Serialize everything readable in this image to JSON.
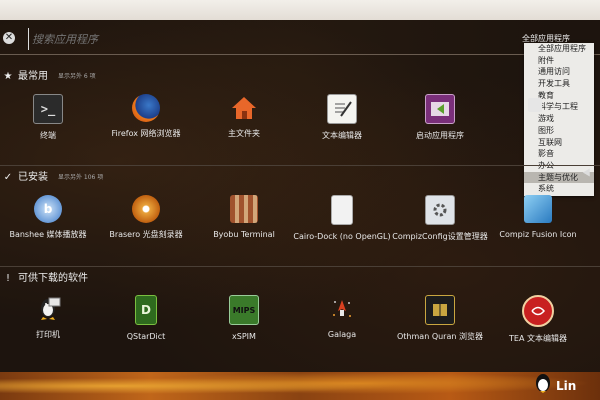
{
  "search": {
    "placeholder": "搜索应用程序"
  },
  "filter": {
    "label": "全部应用程序",
    "options": [
      "全部应用程序",
      "附件",
      "通用访问",
      "开发工具",
      "教育",
      "科学与工程",
      "游戏",
      "图形",
      "互联网",
      "影音",
      "办公",
      "主题与优化",
      "系统"
    ],
    "selected_index": 11
  },
  "sections": [
    {
      "title": "最常用",
      "more": "显示另外 6 项",
      "icon": "star-icon",
      "apps": [
        {
          "label": "终端",
          "icon": "terminal-icon"
        },
        {
          "label": "Firefox 网络浏览器",
          "icon": "firefox-icon"
        },
        {
          "label": "主文件夹",
          "icon": "home-folder-icon"
        },
        {
          "label": "文本编辑器",
          "icon": "text-editor-icon"
        },
        {
          "label": "启动应用程序",
          "icon": "startup-apps-icon"
        }
      ]
    },
    {
      "title": "已安装",
      "more": "显示另外 106 项",
      "icon": "check-circle-icon",
      "apps": [
        {
          "label": "Banshee 媒体播放器",
          "icon": "banshee-icon"
        },
        {
          "label": "Brasero 光盘刻录器",
          "icon": "brasero-icon"
        },
        {
          "label": "Byobu Terminal",
          "icon": "byobu-icon"
        },
        {
          "label": "Cairo-Dock (no OpenGL)",
          "icon": "cairo-dock-icon"
        },
        {
          "label": "CompizConfig设置管理器",
          "icon": "compizconfig-icon"
        },
        {
          "label": "Compiz Fusion Icon",
          "icon": "compiz-fusion-icon"
        }
      ]
    },
    {
      "title": "可供下载的软件",
      "more": "",
      "icon": "info-icon",
      "apps": [
        {
          "label": "打印机",
          "icon": "printer-icon"
        },
        {
          "label": "QStarDict",
          "icon": "qstardict-icon"
        },
        {
          "label": "xSPIM",
          "icon": "xspim-icon"
        },
        {
          "label": "Galaga",
          "icon": "galaga-icon"
        },
        {
          "label": "Othman Quran 浏览器",
          "icon": "othman-quran-icon"
        },
        {
          "label": "TEA 文本编辑器",
          "icon": "tea-editor-icon"
        }
      ]
    }
  ],
  "icon_glyphs": {
    "clear": "✕",
    "star": "★",
    "check": "✓",
    "info": "!",
    "qstardict": "D",
    "xspim": "MIPS"
  },
  "watermark": "Lin"
}
